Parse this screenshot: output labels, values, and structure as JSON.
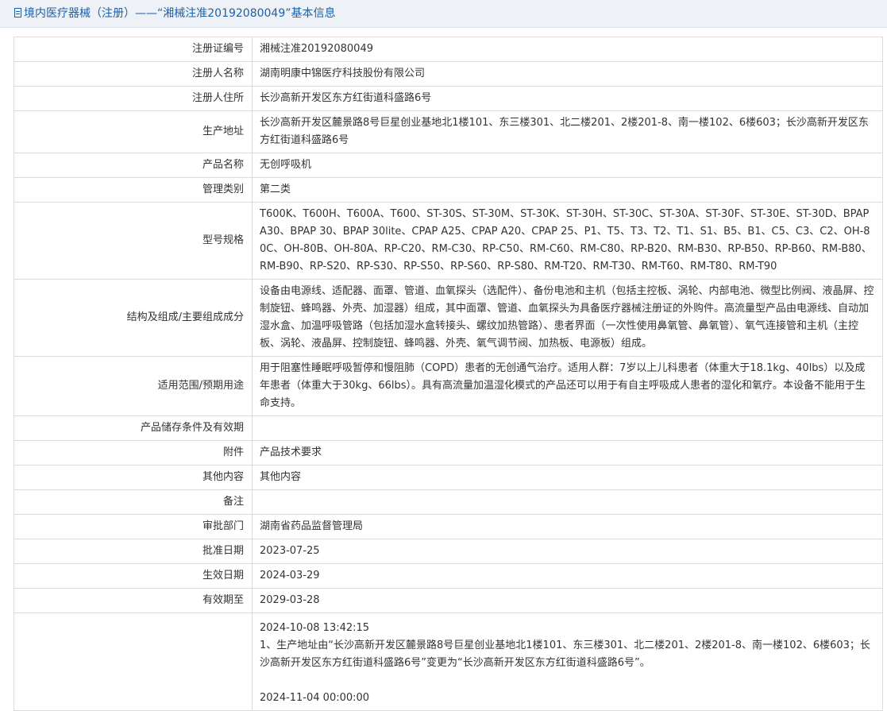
{
  "header": {
    "title": "境内医疗器械（注册）——“湘械注准20192080049”基本信息"
  },
  "rows": [
    {
      "label": "注册证编号",
      "value": "湘械注准20192080049"
    },
    {
      "label": "注册人名称",
      "value": "湖南明康中锦医疗科技股份有限公司"
    },
    {
      "label": "注册人住所",
      "value": "长沙高新开发区东方红街道科盛路6号"
    },
    {
      "label": "生产地址",
      "value": "长沙高新开发区麓景路8号巨星创业基地北1楼101、东三楼301、北二楼201、2楼201-8、南一楼102、6楼603；长沙高新开发区东方红街道科盛路6号"
    },
    {
      "label": "产品名称",
      "value": "无创呼吸机"
    },
    {
      "label": "管理类别",
      "value": "第二类"
    },
    {
      "label": "型号规格",
      "value": "T600K、T600H、T600A、T600、ST-30S、ST-30M、ST-30K、ST-30H、ST-30C、ST-30A、ST-30F、ST-30E、ST-30D、BPAP A30、BPAP 30、BPAP 30lite、CPAP A25、CPAP A20、CPAP 25、P1、T5、T3、T2、T1、S1、B5、B1、C5、C3、C2、OH-80C、OH-80B、OH-80A、RP-C20、RM-C30、RP-C50、RM-C60、RM-C80、RP-B20、RM-B30、RP-B50、RP-B60、RM-B80、RM-B90、RP-S20、RP-S30、RP-S50、RP-S60、RP-S80、RM-T20、RM-T30、RM-T60、RM-T80、RM-T90"
    },
    {
      "label": "结构及组成/主要组成成分",
      "value": "设备由电源线、适配器、面罩、管道、血氧探头（选配件）、备份电池和主机（包括主控板、涡轮、内部电池、微型比例阀、液晶屏、控制旋钮、蜂鸣器、外壳、加湿器）组成，其中面罩、管道、血氧探头为具备医疗器械注册证的外购件。高流量型产品由电源线、自动加湿水盒、加温呼吸管路（包括加湿水盒转接头、螺纹加热管路）、患者界面（一次性使用鼻氧管、鼻氧管）、氧气连接管和主机（主控板、涡轮、液晶屏、控制旋钮、蜂鸣器、外壳、氧气调节阀、加热板、电源板）组成。"
    },
    {
      "label": "适用范围/预期用途",
      "value": "用于阻塞性睡眠呼吸暂停和慢阻肺（COPD）患者的无创通气治疗。适用人群：7岁以上儿科患者（体重大于18.1kg、40lbs）以及成年患者（体重大于30kg、66lbs）。具有高流量加温湿化模式的产品还可以用于有自主呼吸成人患者的湿化和氧疗。本设备不能用于生命支持。"
    },
    {
      "label": "产品储存条件及有效期",
      "value": ""
    },
    {
      "label": "附件",
      "value": "产品技术要求"
    },
    {
      "label": "其他内容",
      "value": "其他内容"
    },
    {
      "label": "备注",
      "value": ""
    },
    {
      "label": "审批部门",
      "value": "湖南省药品监督管理局"
    },
    {
      "label": "批准日期",
      "value": "2023-07-25"
    },
    {
      "label": "生效日期",
      "value": "2024-03-29"
    },
    {
      "label": "有效期至",
      "value": "2029-03-28"
    }
  ],
  "change_log": {
    "label": "",
    "lines": [
      "2024-10-08 13:42:15",
      "1、生产地址由“长沙高新开发区麓景路8号巨星创业基地北1楼101、东三楼301、北二楼201、2楼201-8、南一楼102、6楼603；长沙高新开发区东方红街道科盛路6号”变更为“长沙高新开发区东方红街道科盛路6号”。",
      "",
      "2024-11-04 00:00:00"
    ]
  }
}
